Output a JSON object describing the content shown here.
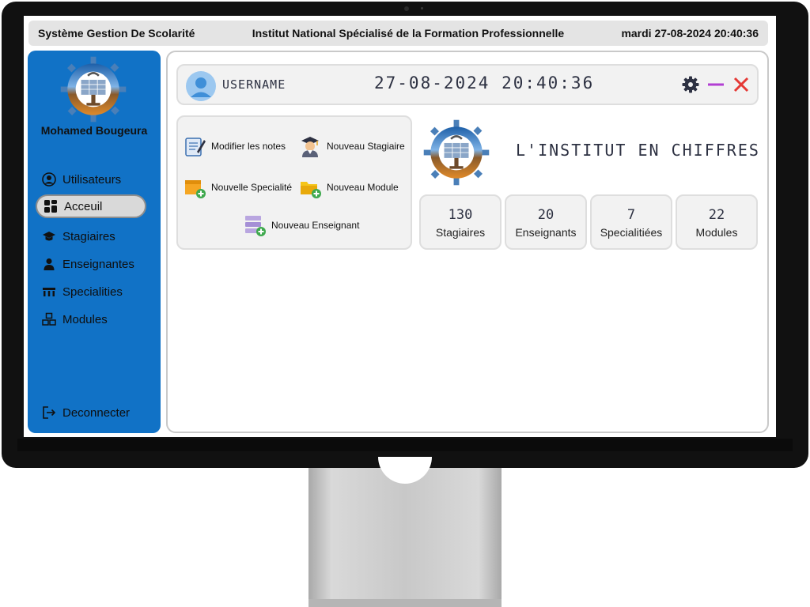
{
  "titlebar": {
    "app_name": "Système Gestion De Scolarité",
    "institute": "Institut National Spécialisé de la Formation Professionnelle",
    "datetime": "mardi 27-08-2024 20:40:36"
  },
  "sidebar": {
    "user_name": "Mohamed Bougeura",
    "items": [
      {
        "label": "Utilisateurs",
        "icon": "user-circle-icon",
        "active": false
      },
      {
        "label": "Acceuil",
        "icon": "dashboard-icon",
        "active": true
      },
      {
        "label": "Stagiaires",
        "icon": "graduation-cap-icon",
        "active": false
      },
      {
        "label": "Enseignantes",
        "icon": "teacher-icon",
        "active": false
      },
      {
        "label": "Specialities",
        "icon": "building-icon",
        "active": false
      },
      {
        "label": "Modules",
        "icon": "cubes-icon",
        "active": false
      }
    ],
    "logout_label": "Deconnecter"
  },
  "header": {
    "username": "USERNAME",
    "clock": "27-08-2024 20:40:36"
  },
  "actions": {
    "modifier_notes": "Modifier les notes",
    "nouveau_stagiaire": "Nouveau Stagiaire",
    "nouvelle_specialite": "Nouvelle Specialité",
    "nouveau_module": "Nouveau Module",
    "nouveau_enseignant": "Nouveau Enseignant"
  },
  "stats": {
    "title": "L'INSTITUT EN CHIFFRES",
    "cards": [
      {
        "value": "130",
        "label": "Stagiaires"
      },
      {
        "value": "20",
        "label": "Enseignants"
      },
      {
        "value": "7",
        "label": "Specialitiées"
      },
      {
        "value": "22",
        "label": "Modules"
      }
    ]
  },
  "colors": {
    "sidebar_bg": "#1172c6",
    "accent_purple": "#b23fd3",
    "close_red": "#e53935",
    "card_bg": "#f2f2f2"
  }
}
